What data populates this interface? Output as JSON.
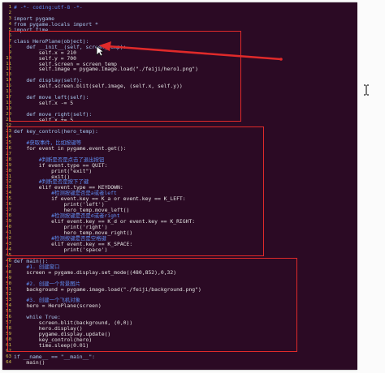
{
  "editor": {
    "lines": [
      {
        "n": "1",
        "t": "# -*- coding:utf-8 -*-",
        "c": "c-comment"
      },
      {
        "n": "2",
        "t": "",
        "c": ""
      },
      {
        "n": "3",
        "t": "import pygame",
        "c": "c-blue"
      },
      {
        "n": "4",
        "t": "from pygame.locals import *",
        "c": "c-blue"
      },
      {
        "n": "5",
        "t": "import time",
        "c": "c-blue"
      },
      {
        "n": "6",
        "t": "",
        "c": ""
      },
      {
        "n": "7",
        "t": "class HeroPlane(object):",
        "c": "c-blue"
      },
      {
        "n": "8",
        "t": "    def __init__(self, screen_temp):",
        "c": "c-blue"
      },
      {
        "n": "9",
        "t": "        self.x = 210",
        "c": "c-white"
      },
      {
        "n": "10",
        "t": "        self.y = 700",
        "c": "c-white"
      },
      {
        "n": "11",
        "t": "        self.screen = screen_temp",
        "c": "c-white"
      },
      {
        "n": "12",
        "t": "        self.image = pygame.image.load(\"./feiji/hero1.png\")",
        "c": "c-white"
      },
      {
        "n": "13",
        "t": "",
        "c": ""
      },
      {
        "n": "14",
        "t": "    def display(self):",
        "c": "c-blue"
      },
      {
        "n": "15",
        "t": "        self.screen.blit(self.image, (self.x, self.y))",
        "c": "c-white"
      },
      {
        "n": "16",
        "t": "",
        "c": ""
      },
      {
        "n": "17",
        "t": "    def move_left(self):",
        "c": "c-blue"
      },
      {
        "n": "18",
        "t": "        self.x -= 5",
        "c": "c-white"
      },
      {
        "n": "19",
        "t": "",
        "c": ""
      },
      {
        "n": "20",
        "t": "    def move_right(self):",
        "c": "c-blue"
      },
      {
        "n": "21",
        "t": "        self.x += 5",
        "c": "c-white"
      },
      {
        "n": "22",
        "t": "",
        "c": ""
      },
      {
        "n": "23",
        "t": "def key_control(hero_temp):",
        "c": "c-blue"
      },
      {
        "n": "24",
        "t": "",
        "c": ""
      },
      {
        "n": "25",
        "t": "    #获取事件，比如按键等",
        "c": "c-comment"
      },
      {
        "n": "26",
        "t": "    for event in pygame.event.get():",
        "c": "c-white"
      },
      {
        "n": "27",
        "t": "",
        "c": ""
      },
      {
        "n": "28",
        "t": "        #判断是否是点击了退出按钮",
        "c": "c-comment"
      },
      {
        "n": "29",
        "t": "        if event.type == QUIT:",
        "c": "c-white"
      },
      {
        "n": "30",
        "t": "            print(\"exit\")",
        "c": "c-white"
      },
      {
        "n": "31",
        "t": "            exit()",
        "c": "c-white"
      },
      {
        "n": "32",
        "t": "        #判断是否是按下了键",
        "c": "c-comment"
      },
      {
        "n": "33",
        "t": "        elif event.type == KEYDOWN:",
        "c": "c-white"
      },
      {
        "n": "34",
        "t": "            #检测按键是否是a或者left",
        "c": "c-comment"
      },
      {
        "n": "35",
        "t": "            if event.key == K_a or event.key == K_LEFT:",
        "c": "c-white"
      },
      {
        "n": "36",
        "t": "                print('left')",
        "c": "c-white"
      },
      {
        "n": "37",
        "t": "                hero_temp.move_left()",
        "c": "c-white"
      },
      {
        "n": "38",
        "t": "            #检测按键是否是d或者right",
        "c": "c-comment"
      },
      {
        "n": "39",
        "t": "            elif event.key == K_d or event.key == K_RIGHT:",
        "c": "c-white"
      },
      {
        "n": "40",
        "t": "                print('right')",
        "c": "c-white"
      },
      {
        "n": "41",
        "t": "                hero_temp.move_right()",
        "c": "c-white"
      },
      {
        "n": "42",
        "t": "            #检测按键是否是空格键",
        "c": "c-comment"
      },
      {
        "n": "43",
        "t": "            elif event.key == K_SPACE:",
        "c": "c-white"
      },
      {
        "n": "44",
        "t": "                print('space')",
        "c": "c-white"
      },
      {
        "n": "45",
        "t": "",
        "c": ""
      },
      {
        "n": "46",
        "t": "def main():",
        "c": "c-blue"
      },
      {
        "n": "47",
        "t": "    #1. 创建窗口",
        "c": "c-comment"
      },
      {
        "n": "48",
        "t": "    screen = pygame.display.set_mode((480,852),0,32)",
        "c": "c-white"
      },
      {
        "n": "49",
        "t": "",
        "c": ""
      },
      {
        "n": "50",
        "t": "    #2. 创建一个背景图片",
        "c": "c-comment"
      },
      {
        "n": "51",
        "t": "    background = pygame.image.load(\"./feiji/background.png\")",
        "c": "c-white"
      },
      {
        "n": "52",
        "t": "",
        "c": ""
      },
      {
        "n": "53",
        "t": "    #3. 创建一个飞机对象",
        "c": "c-comment"
      },
      {
        "n": "54",
        "t": "    hero = HeroPlane(screen)",
        "c": "c-white"
      },
      {
        "n": "55",
        "t": "",
        "c": ""
      },
      {
        "n": "56",
        "t": "    while True:",
        "c": "c-blue"
      },
      {
        "n": "57",
        "t": "        screen.blit(background, (0,0))",
        "c": "c-white"
      },
      {
        "n": "58",
        "t": "        hero.display()",
        "c": "c-white"
      },
      {
        "n": "59",
        "t": "        pygame.display.update()",
        "c": "c-white"
      },
      {
        "n": "60",
        "t": "        key_control(hero)",
        "c": "c-white"
      },
      {
        "n": "61",
        "t": "        time.sleep(0.01)",
        "c": "c-white"
      },
      {
        "n": "62",
        "t": "",
        "c": ""
      },
      {
        "n": "63",
        "t": "if __name__ == \"__main__\":",
        "c": "c-blue"
      },
      {
        "n": "64",
        "t": "    main()",
        "c": "c-white"
      }
    ]
  },
  "annotations": {
    "color": "#e02a2a",
    "regions": [
      "class-heroplane-box",
      "key-control-box",
      "main-box"
    ]
  },
  "icons": [
    "ibeam-cursor-icon",
    "mouse-pointer-icon",
    "annotation-arrow"
  ]
}
